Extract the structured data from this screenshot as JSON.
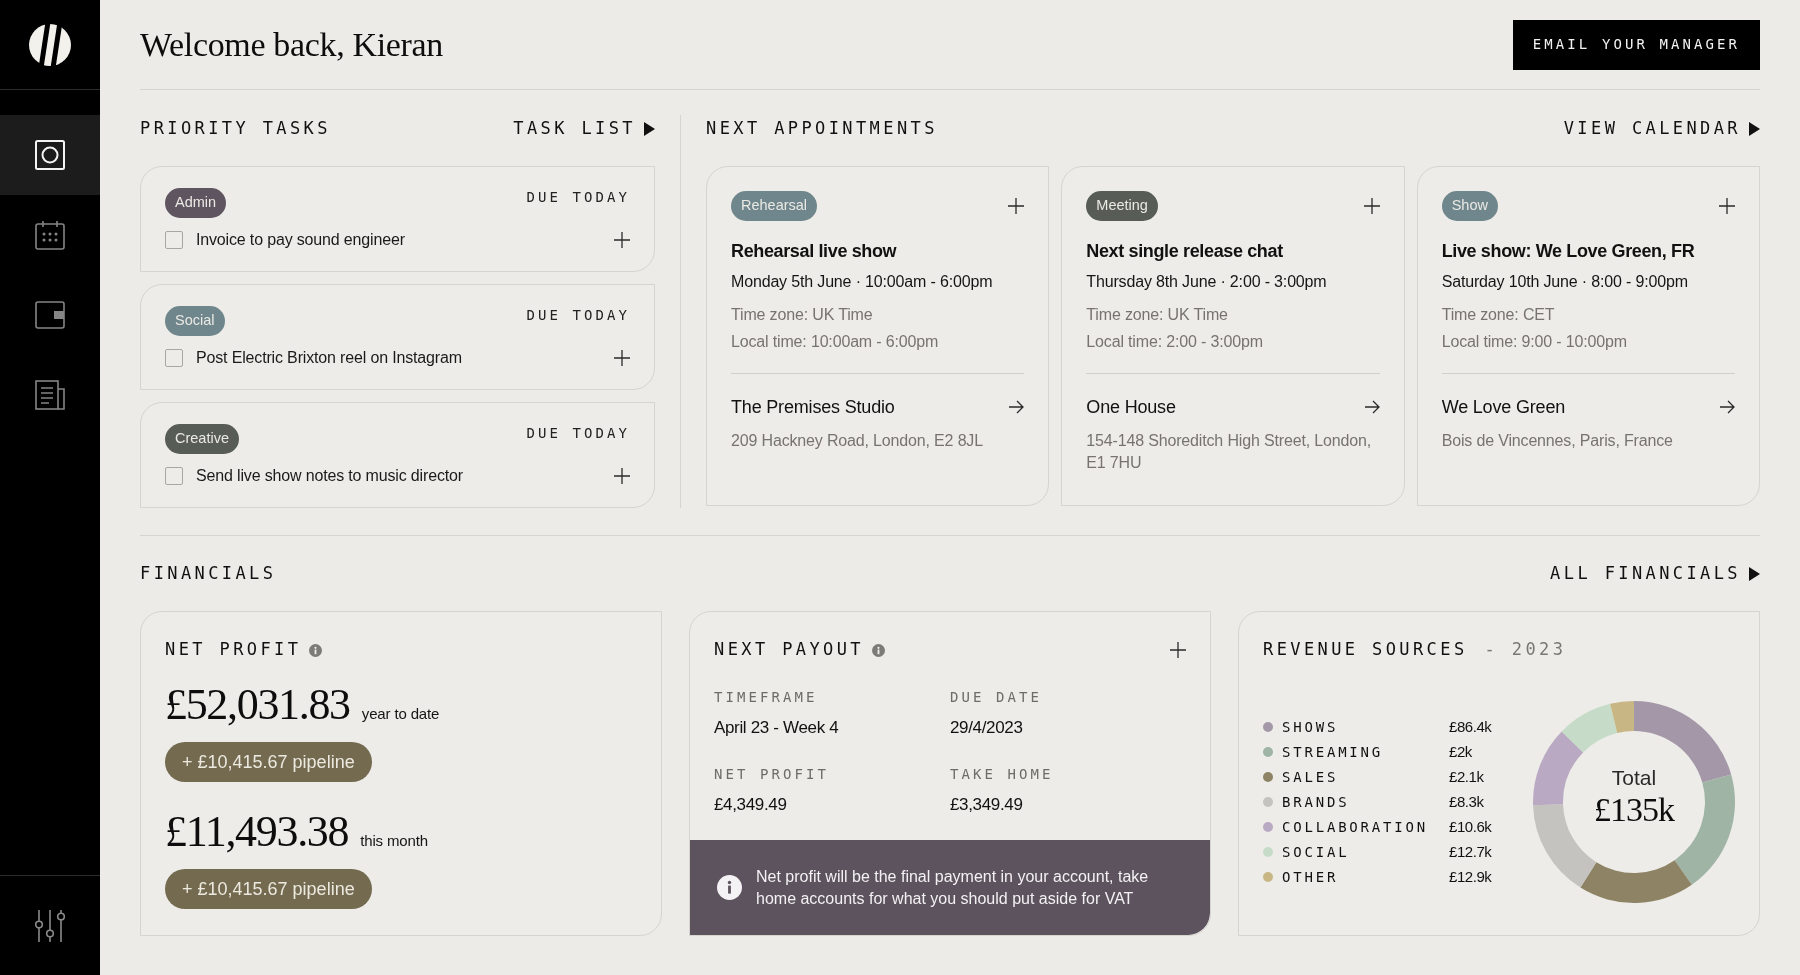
{
  "sidebar": {
    "nav_items": [
      {
        "selected": true
      },
      {
        "selected": false
      },
      {
        "selected": false
      },
      {
        "selected": false
      }
    ]
  },
  "header": {
    "title": "Welcome back, Kieran",
    "button": "EMAIL YOUR MANAGER"
  },
  "priority_tasks": {
    "title": "PRIORITY TASKS",
    "link": "TASK LIST",
    "tasks": [
      {
        "tag": {
          "label": "Admin",
          "color": "#5e5560"
        },
        "due": "DUE TODAY",
        "label": "Invoice to pay sound engineer",
        "checked": false
      },
      {
        "tag": {
          "label": "Social",
          "color": "#6f868c"
        },
        "due": "DUE TODAY",
        "label": "Post Electric Brixton reel on Instagram",
        "checked": false
      },
      {
        "tag": {
          "label": "Creative",
          "color": "#575d56"
        },
        "due": "DUE TODAY",
        "label": "Send live show notes to music director",
        "checked": false
      }
    ]
  },
  "appointments": {
    "title": "NEXT APPOINTMENTS",
    "link": "VIEW CALENDAR",
    "items": [
      {
        "tag": {
          "label": "Rehearsal",
          "color": "#6f868c"
        },
        "title": "Rehearsal live show",
        "when": "Monday 5th June · 10:00am - 6:00pm",
        "time_zone": "Time zone: UK Time",
        "local_time": "Local time: 10:00am - 6:00pm",
        "venue": "The Premises Studio",
        "address": "209 Hackney Road, London, E2 8JL"
      },
      {
        "tag": {
          "label": "Meeting",
          "color": "#575d56"
        },
        "title": "Next single release chat",
        "when": "Thursday 8th June · 2:00 - 3:00pm",
        "time_zone": "Time zone: UK Time",
        "local_time": "Local time: 2:00 - 3:00pm",
        "venue": "One House",
        "address": "154-148 Shoreditch High Street, London, E1 7HU"
      },
      {
        "tag": {
          "label": "Show",
          "color": "#6f868c"
        },
        "title": "Live show: We Love Green, FR",
        "when": "Saturday 10th June · 8:00 - 9:00pm",
        "time_zone": "Time zone: CET",
        "local_time": "Local time: 9:00 - 10:00pm",
        "venue": "We Love Green",
        "address": "Bois de Vincennes, Paris, France"
      }
    ]
  },
  "financials": {
    "title": "FINANCIALS",
    "link": "ALL FINANCIALS",
    "net_profit": {
      "title": "NET PROFIT",
      "figures": [
        {
          "amount": "£52,031.83",
          "period": "year to date",
          "pipeline": "+ £10,415.67 pipeline"
        },
        {
          "amount": "£11,493.38",
          "period": "this month",
          "pipeline": "+ £10,415.67 pipeline"
        }
      ]
    },
    "next_payout": {
      "title": "NEXT PAYOUT",
      "fields": [
        {
          "label": "TIMEFRAME",
          "value": "April 23 - Week 4"
        },
        {
          "label": "DUE DATE",
          "value": "29/4/2023"
        },
        {
          "label": "NET PROFIT",
          "value": "£4,349.49"
        },
        {
          "label": "TAKE HOME",
          "value": "£3,349.49"
        }
      ],
      "note": "Net profit will be the final payment in your account, take home accounts for what you should put aside for VAT"
    },
    "revenue_sources": {
      "title": "REVENUE SOURCES",
      "year": "- 2023",
      "legend": [
        {
          "label": "SHOWS",
          "amount": "£86.4k",
          "color": "#a498a8"
        },
        {
          "label": "STREAMING",
          "amount": "£2k",
          "color": "#9fb4a5"
        },
        {
          "label": "SALES",
          "amount": "£2.1k",
          "color": "#8e8465"
        },
        {
          "label": "BRANDS",
          "amount": "£8.3k",
          "color": "#c4c3bf"
        },
        {
          "label": "COLLABORATION",
          "amount": "£10.6k",
          "color": "#baa9c2"
        },
        {
          "label": "SOCIAL",
          "amount": "£12.7k",
          "color": "#c6dcc8"
        },
        {
          "label": "OTHER",
          "amount": "£12.9k",
          "color": "#c9b685"
        }
      ],
      "total_label": "Total",
      "total": "£135k",
      "chart_data": {
        "type": "donut",
        "values": [
          20.6,
          19.7,
          18.6,
          15.6,
          12.8,
          8.9,
          3.8
        ]
      }
    }
  }
}
